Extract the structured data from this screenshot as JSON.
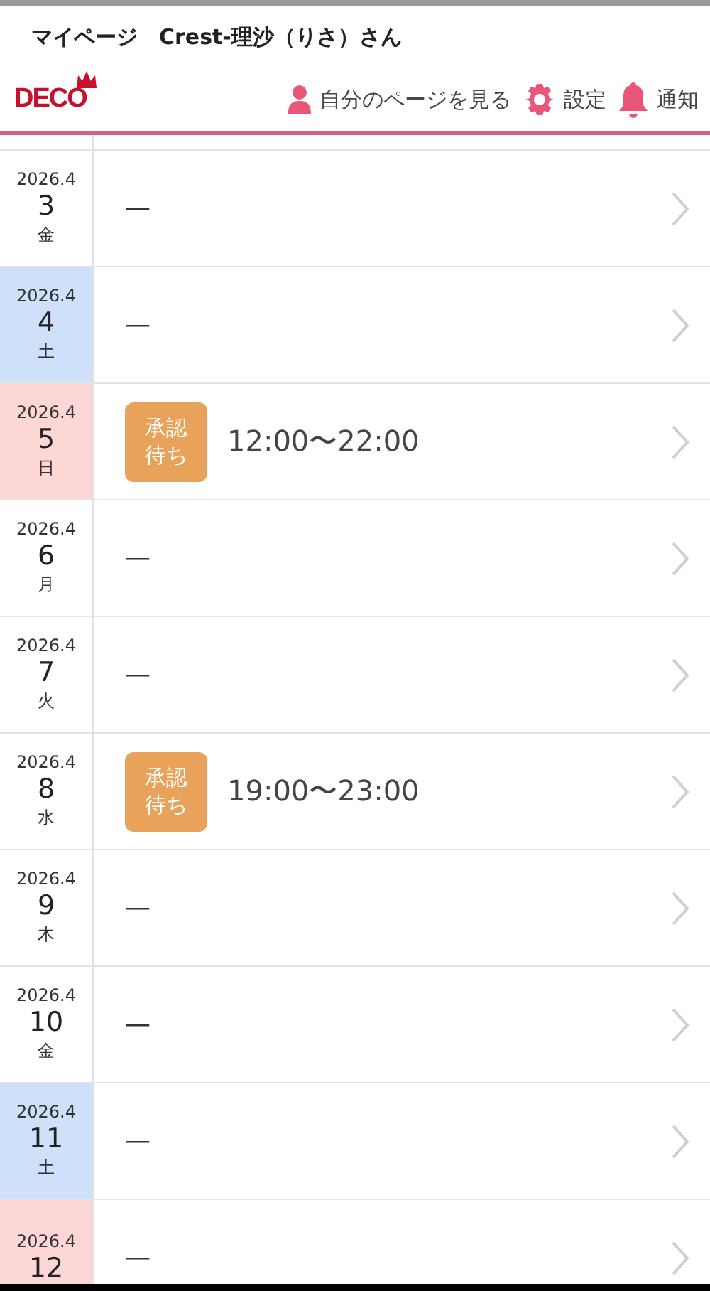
{
  "title_bar": {
    "title": "マイページ　Crest-理沙（りさ）さん"
  },
  "header": {
    "logo": "DECO",
    "links": [
      {
        "kind": "person",
        "label": "自分のページを見る"
      },
      {
        "kind": "gear",
        "label": "設定"
      },
      {
        "kind": "bell",
        "label": "通知"
      }
    ]
  },
  "days": [
    {
      "month": "2026.4",
      "day": "3",
      "weekday": "金",
      "kind": "weekday",
      "entry": "—"
    },
    {
      "month": "2026.4",
      "day": "4",
      "weekday": "土",
      "kind": "saturday",
      "entry": "—"
    },
    {
      "month": "2026.4",
      "day": "5",
      "weekday": "日",
      "kind": "sunday",
      "badge": "承認待ち",
      "time": "12:00〜22:00"
    },
    {
      "month": "2026.4",
      "day": "6",
      "weekday": "月",
      "kind": "weekday",
      "entry": "—"
    },
    {
      "month": "2026.4",
      "day": "7",
      "weekday": "火",
      "kind": "weekday",
      "entry": "—"
    },
    {
      "month": "2026.4",
      "day": "8",
      "weekday": "水",
      "kind": "weekday",
      "badge": "承認待ち",
      "time": "19:00〜23:00"
    },
    {
      "month": "2026.4",
      "day": "9",
      "weekday": "木",
      "kind": "weekday",
      "entry": "—"
    },
    {
      "month": "2026.4",
      "day": "10",
      "weekday": "金",
      "kind": "weekday",
      "entry": "—"
    },
    {
      "month": "2026.4",
      "day": "11",
      "weekday": "土",
      "kind": "saturday",
      "entry": "—"
    },
    {
      "month": "2026.4",
      "day": "12",
      "kind": "sunday",
      "entry": "—"
    }
  ]
}
